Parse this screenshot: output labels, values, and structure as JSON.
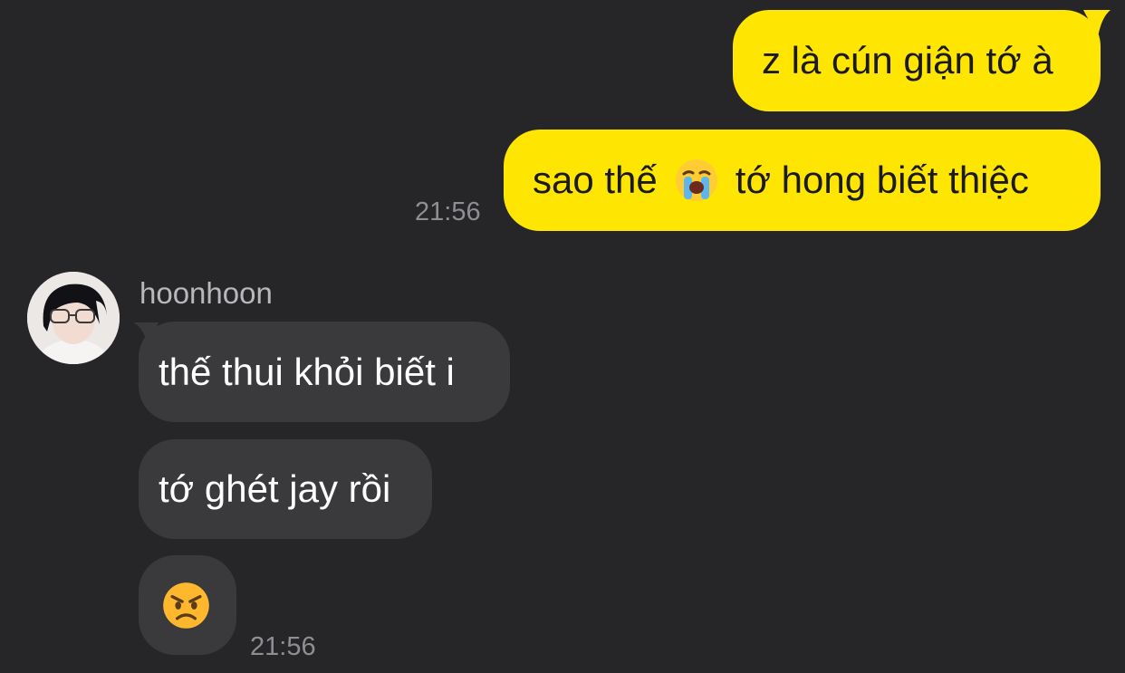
{
  "messages": {
    "out1": "z là cún giận tớ à",
    "out2_before": "sao thế",
    "out2_emoji": "loudly-crying-face",
    "out2_after": "tớ hong biết thiệc",
    "out_time": "21:56",
    "sender_name": "hoonhoon",
    "in1": "thế thui khỏi biết i",
    "in2": "tớ ghét jay rồi",
    "in3_emoji": "angry-face",
    "in_time": "21:56"
  },
  "colors": {
    "background": "#262628",
    "outgoing_bubble": "#ffe502",
    "incoming_bubble": "#3a3a3c",
    "timestamp": "#8e8e93"
  }
}
